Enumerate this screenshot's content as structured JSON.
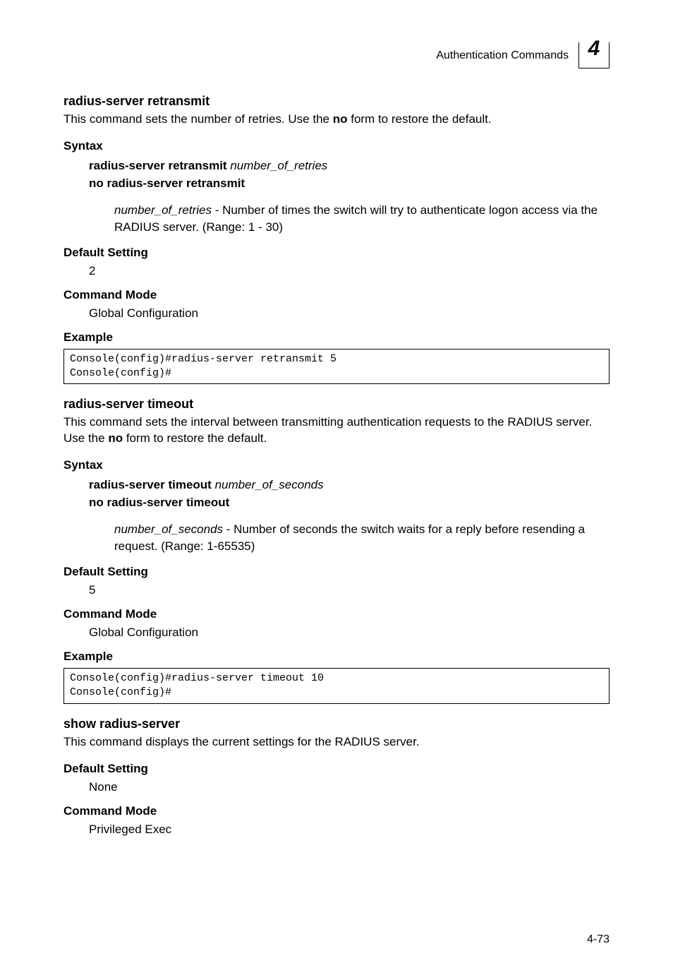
{
  "header": {
    "title": "Authentication Commands",
    "chapter": "4"
  },
  "sections": [
    {
      "heading": "radius-server retransmit",
      "desc_parts": [
        "This command sets the number of retries. Use the ",
        "no",
        " form to restore the default."
      ],
      "syntax": {
        "label": "Syntax",
        "line1_bold": "radius-server retransmit",
        "line1_ital": "number_of_retries",
        "line2_bold": "no radius-server retransmit",
        "param_ital": "number_of_retries",
        "param_rest": " - Number of times the switch will try to authenticate logon access via the RADIUS server. (Range: 1 - 30)"
      },
      "default": {
        "label": "Default Setting",
        "value": "2"
      },
      "mode": {
        "label": "Command Mode",
        "value": "Global Configuration"
      },
      "example": {
        "label": "Example",
        "code": "Console(config)#radius-server retransmit 5\nConsole(config)#"
      }
    },
    {
      "heading": "radius-server timeout",
      "desc_parts": [
        "This command sets the interval between transmitting authentication requests to the RADIUS server. Use the ",
        "no",
        " form to restore the default."
      ],
      "syntax": {
        "label": "Syntax",
        "line1_bold": "radius-server timeout",
        "line1_ital": "number_of_seconds",
        "line2_bold": "no radius-server timeout",
        "param_ital": "number_of_seconds",
        "param_rest": " - Number of seconds the switch waits for a reply before resending a request. (Range: 1-65535)"
      },
      "default": {
        "label": "Default Setting",
        "value": "5"
      },
      "mode": {
        "label": "Command Mode",
        "value": "Global Configuration"
      },
      "example": {
        "label": "Example",
        "code": "Console(config)#radius-server timeout 10\nConsole(config)#"
      }
    },
    {
      "heading": "show radius-server",
      "desc_plain": "This command displays the current settings for the RADIUS server.",
      "default": {
        "label": "Default Setting",
        "value": "None"
      },
      "mode": {
        "label": "Command Mode",
        "value": "Privileged Exec"
      }
    }
  ],
  "page_number": "4-73"
}
